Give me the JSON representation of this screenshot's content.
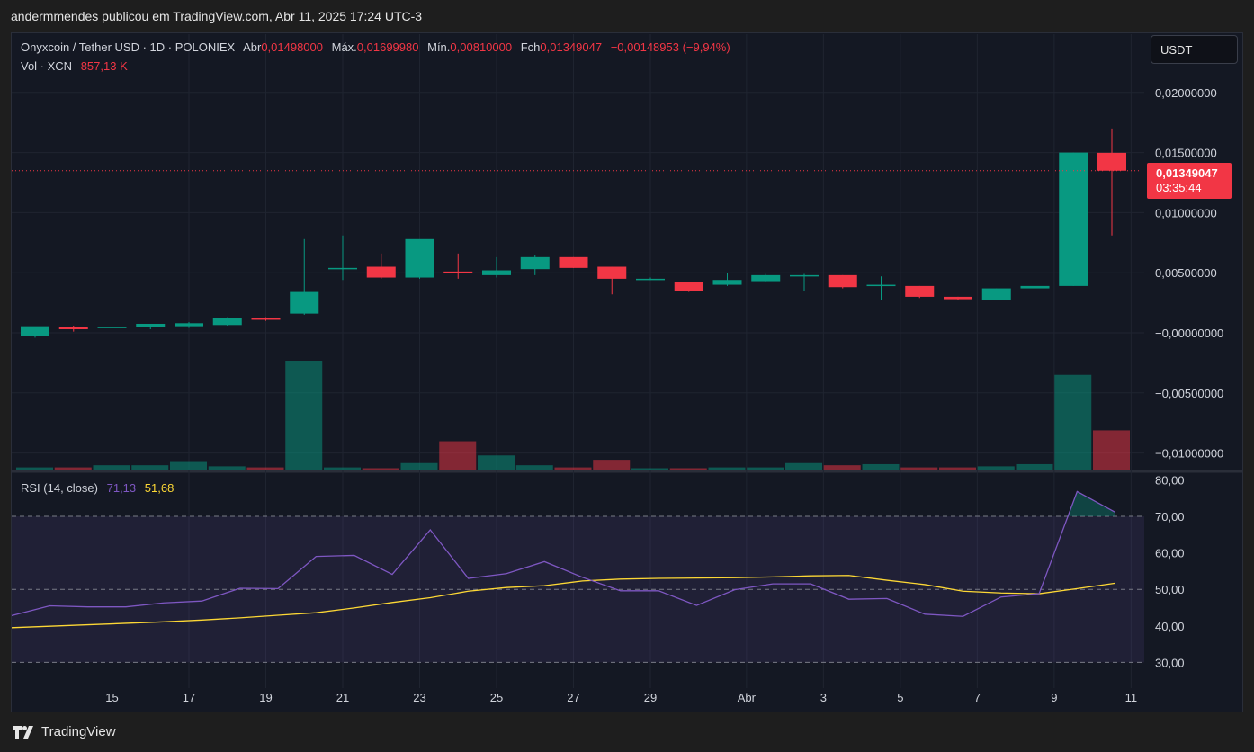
{
  "header": {
    "publisher_line": "andermmendes publicou em TradingView.com, Abr 11, 2025 17:24 UTC-3"
  },
  "legend": {
    "symbol": "Onyxcoin / Tether USD · 1D · POLONIEX",
    "open_label": "Abr",
    "open_value": "0,01498000",
    "high_label": "Máx.",
    "high_value": "0,01699980",
    "low_label": "Mín.",
    "low_value": "0,00810000",
    "close_label": "Fch",
    "close_value": "0,01349047",
    "change": "−0,00148953 (−9,94%)",
    "vol_label": "Vol · XCN",
    "vol_value": "857,13 K"
  },
  "rsi_legend": {
    "label": "RSI (14, close)",
    "rsi_value": "71,13",
    "ma_value": "51,68"
  },
  "currency_button": "USDT",
  "price_tag": {
    "price": "0,01349047",
    "countdown": "03:35:44"
  },
  "footer": {
    "brand": "TradingView"
  },
  "colors": {
    "up": "#089981",
    "down": "#f23645",
    "rsi_line": "#7e57c2",
    "rsi_ma": "#fdd835"
  },
  "chart_data": [
    {
      "type": "candlestick",
      "title": "Onyxcoin / Tether USD · 1D · POLONIEX",
      "y_ticks": [
        "0,02000000",
        "0,01500000",
        "0,01000000",
        "0,00500000",
        "−0,00000000",
        "−0,00500000",
        "−0,01000000"
      ],
      "y_tick_values": [
        0.02,
        0.015,
        0.01,
        0.005,
        0,
        -0.005,
        -0.01
      ],
      "x_ticks": [
        {
          "label": "15",
          "index": 2
        },
        {
          "label": "17",
          "index": 4
        },
        {
          "label": "19",
          "index": 6
        },
        {
          "label": "21",
          "index": 8
        },
        {
          "label": "23",
          "index": 10
        },
        {
          "label": "25",
          "index": 12
        },
        {
          "label": "27",
          "index": 14
        },
        {
          "label": "29",
          "index": 16
        },
        {
          "label": "Abr",
          "index": 18.5
        },
        {
          "label": "3",
          "index": 20.5
        },
        {
          "label": "5",
          "index": 22.5
        },
        {
          "label": "7",
          "index": 24.5
        },
        {
          "label": "9",
          "index": 26.5
        },
        {
          "label": "11",
          "index": 28.5
        }
      ],
      "candles": [
        {
          "o": -0.0003,
          "h": 0.00015,
          "l": -0.0004,
          "c": 0.00055
        },
        {
          "o": 0.00045,
          "h": 0.0006,
          "l": 0.0001,
          "c": 0.0003
        },
        {
          "o": 0.00045,
          "h": 0.0007,
          "l": 0.0003,
          "c": 0.0005
        },
        {
          "o": 0.00045,
          "h": 0.0006,
          "l": 0.0003,
          "c": 0.00075
        },
        {
          "o": 0.00055,
          "h": 0.0009,
          "l": 0.0004,
          "c": 0.0008
        },
        {
          "o": 0.00065,
          "h": 0.0013,
          "l": 0.0006,
          "c": 0.0012
        },
        {
          "o": 0.0012,
          "h": 0.0013,
          "l": 0.001,
          "c": 0.00115
        },
        {
          "o": 0.0016,
          "h": 0.0078,
          "l": 0.0015,
          "c": 0.0034
        },
        {
          "o": 0.0054,
          "h": 0.0081,
          "l": 0.0044,
          "c": 0.0054
        },
        {
          "o": 0.0055,
          "h": 0.0066,
          "l": 0.0045,
          "c": 0.0046
        },
        {
          "o": 0.0046,
          "h": 0.0077,
          "l": 0.0045,
          "c": 0.0078
        },
        {
          "o": 0.0051,
          "h": 0.0066,
          "l": 0.0045,
          "c": 0.005
        },
        {
          "o": 0.0048,
          "h": 0.0063,
          "l": 0.0046,
          "c": 0.0052
        },
        {
          "o": 0.0053,
          "h": 0.0065,
          "l": 0.0048,
          "c": 0.0063
        },
        {
          "o": 0.0063,
          "h": 0.0063,
          "l": 0.0054,
          "c": 0.0054
        },
        {
          "o": 0.0055,
          "h": 0.0055,
          "l": 0.0032,
          "c": 0.0045
        },
        {
          "o": 0.0045,
          "h": 0.0046,
          "l": 0.0044,
          "c": 0.0045
        },
        {
          "o": 0.0042,
          "h": 0.0042,
          "l": 0.0034,
          "c": 0.0035
        },
        {
          "o": 0.004,
          "h": 0.005,
          "l": 0.0039,
          "c": 0.0044
        },
        {
          "o": 0.0043,
          "h": 0.0049,
          "l": 0.0042,
          "c": 0.0048
        },
        {
          "o": 0.0048,
          "h": 0.0049,
          "l": 0.0035,
          "c": 0.0048
        },
        {
          "o": 0.0048,
          "h": 0.0048,
          "l": 0.0037,
          "c": 0.0038
        },
        {
          "o": 0.0039,
          "h": 0.0047,
          "l": 0.0027,
          "c": 0.004
        },
        {
          "o": 0.0039,
          "h": 0.0039,
          "l": 0.0029,
          "c": 0.003
        },
        {
          "o": 0.003,
          "h": 0.003,
          "l": 0.0027,
          "c": 0.0028
        },
        {
          "o": 0.0027,
          "h": 0.0037,
          "l": 0.0027,
          "c": 0.0037
        },
        {
          "o": 0.0037,
          "h": 0.005,
          "l": 0.0033,
          "c": 0.0039
        },
        {
          "o": 0.0039,
          "h": 0.015,
          "l": 0.0039,
          "c": 0.015
        },
        {
          "o": 0.01498,
          "h": 0.0169998,
          "l": 0.0081,
          "c": 0.01349047
        }
      ],
      "volume_relative": [
        0.02,
        0.02,
        0.04,
        0.04,
        0.07,
        0.03,
        0.02,
        1,
        0.02,
        0.01,
        0.06,
        0.26,
        0.13,
        0.04,
        0.02,
        0.09,
        0.01,
        0.01,
        0.02,
        0.02,
        0.06,
        0.04,
        0.05,
        0.02,
        0.02,
        0.03,
        0.05,
        0.87,
        0.36
      ]
    },
    {
      "type": "line",
      "title": "RSI (14, close)",
      "y_ticks": [
        "80,00",
        "70,00",
        "60,00",
        "50,00",
        "40,00",
        "30,00"
      ],
      "y_tick_values": [
        80,
        70,
        60,
        50,
        40,
        30
      ],
      "ylim": [
        28,
        80.5
      ],
      "bands": [
        70,
        50,
        30
      ],
      "series": [
        {
          "values": [
            42.8,
            45.5,
            45.2,
            45.2,
            46.3,
            46.8,
            50.3,
            50.2,
            59,
            59.3,
            54.1,
            66.3,
            53,
            54.3,
            57.6,
            53.3,
            49.6,
            49.6,
            45.6,
            49.9,
            51.5,
            51.5,
            47.3,
            47.5,
            43.2,
            42.6,
            47.9,
            48.8,
            76.8,
            71.13
          ]
        },
        {
          "values": [
            39.5,
            39.9,
            40.3,
            40.7,
            41.1,
            41.6,
            42.2,
            42.9,
            43.6,
            44.9,
            46.4,
            47.7,
            49.5,
            50.5,
            51,
            52.3,
            52.8,
            53,
            53.1,
            53.2,
            53.4,
            53.7,
            53.8,
            52.5,
            51.3,
            49.5,
            49,
            48.8,
            50.2,
            51.68
          ]
        }
      ]
    }
  ]
}
